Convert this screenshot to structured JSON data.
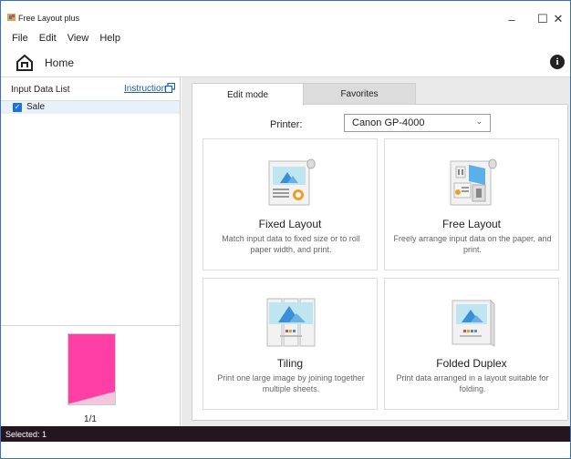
{
  "window": {
    "title": "Free Layout plus",
    "minimize_icon": "minimize-icon",
    "maximize_icon": "maximize-icon",
    "close_icon": "close-icon"
  },
  "menu": [
    "File",
    "Edit",
    "View",
    "Help"
  ],
  "home": {
    "label": "Home",
    "icon": "home-icon",
    "info_icon": "info-icon"
  },
  "left_panel": {
    "title": "Input Data List",
    "instructions": "Instructions",
    "items": [
      {
        "label": "Sale",
        "checked": true
      }
    ],
    "preview": {
      "page": "1/1",
      "thumb_color": "#ff3fa6"
    }
  },
  "tabs": [
    {
      "label": "Edit mode",
      "active": true
    },
    {
      "label": "Favorites",
      "active": false
    }
  ],
  "printer": {
    "label": "Printer:",
    "value": "Canon GP-4000"
  },
  "cards": [
    {
      "title": "Fixed Layout",
      "desc": "Match input data to fixed size or to roll paper width, and print.",
      "icon": "fixed-layout-icon"
    },
    {
      "title": "Free Layout",
      "desc": "Freely arrange input data on the paper, and print.",
      "icon": "free-layout-icon"
    },
    {
      "title": "Tiling",
      "desc": "Print one large image by joining together multiple sheets.",
      "icon": "tiling-icon"
    },
    {
      "title": "Folded Duplex",
      "desc": "Print data arranged in a layout suitable for folding.",
      "icon": "folded-duplex-icon"
    }
  ],
  "status": {
    "text": "Selected: 1"
  },
  "colors": {
    "accent": "#1a73d9",
    "status_bar": "#23161f",
    "link": "#1a5fb4"
  }
}
